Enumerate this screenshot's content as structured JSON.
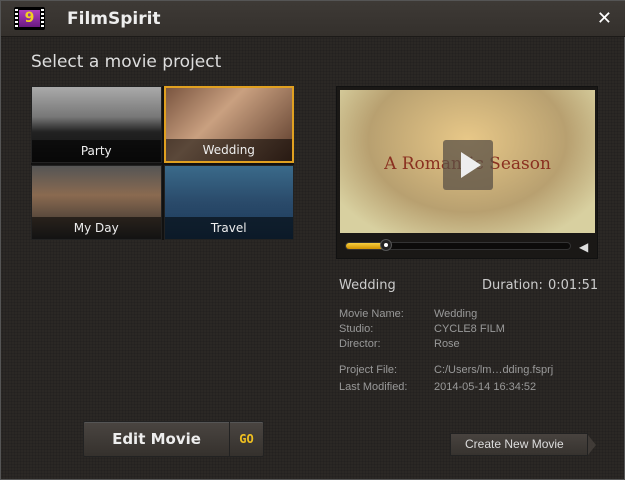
{
  "window": {
    "title": "FilmSpirit",
    "close_label": "✕"
  },
  "heading": "Select a movie project",
  "projects": [
    {
      "label": "Party"
    },
    {
      "label": "Wedding",
      "selected": true
    },
    {
      "label": "My Day"
    },
    {
      "label": "Travel"
    }
  ],
  "player": {
    "video_title": "A Romantic Season",
    "progress": 0.18,
    "volume_icon": "speaker-icon"
  },
  "details": {
    "name": "Wedding",
    "duration_label": "Duration:",
    "duration": "0:01:51",
    "fields": [
      {
        "label": "Movie Name:",
        "value": "Wedding"
      },
      {
        "label": "Studio:",
        "value": "CYCLE8 FILM"
      },
      {
        "label": "Director:",
        "value": "Rose"
      },
      {
        "label": "Project File:",
        "value": "C:/Users/lm…dding.fsprj"
      },
      {
        "label": "Last Modified:",
        "value": "2014-05-14 16:34:52"
      }
    ]
  },
  "buttons": {
    "edit": "Edit Movie",
    "go": "GO",
    "create": "Create New Movie"
  },
  "colors": {
    "accent": "#e0a020"
  }
}
